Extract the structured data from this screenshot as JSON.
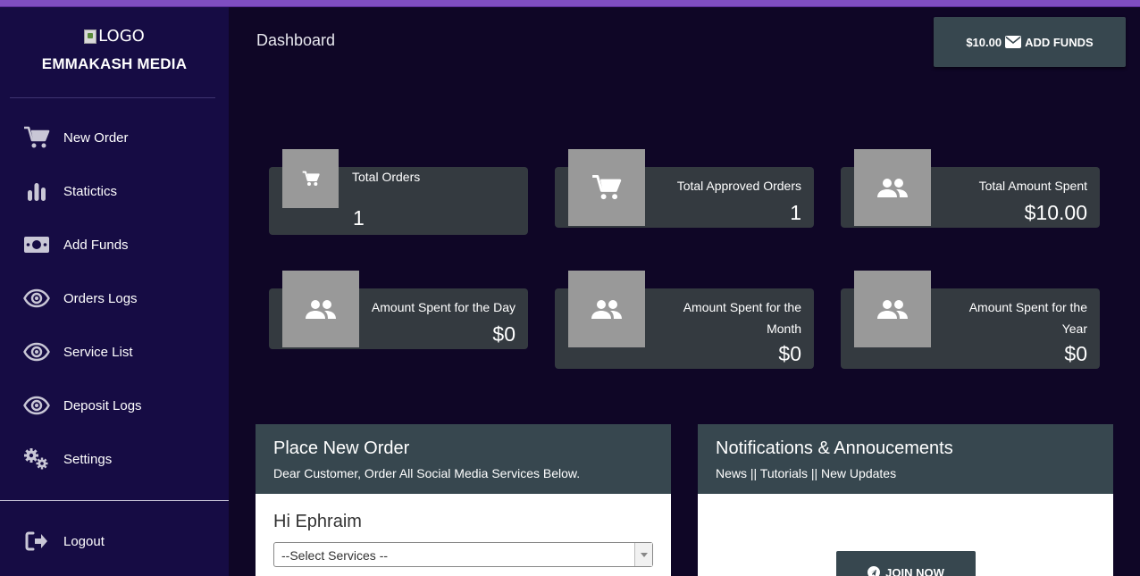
{
  "brand": {
    "logo_alt": "LOGO",
    "name": "EMMAKASH MEDIA"
  },
  "sidebar": {
    "items": [
      {
        "label": "New Order",
        "icon": "cart-icon"
      },
      {
        "label": "Statictics",
        "icon": "bar-chart-icon"
      },
      {
        "label": "Add Funds",
        "icon": "money-icon"
      },
      {
        "label": "Orders Logs",
        "icon": "eye-icon"
      },
      {
        "label": "Service List",
        "icon": "eye-icon"
      },
      {
        "label": "Deposit Logs",
        "icon": "eye-icon"
      },
      {
        "label": "Settings",
        "icon": "gears-icon"
      }
    ],
    "logout": {
      "label": "Logout",
      "icon": "logout-icon"
    }
  },
  "header": {
    "title": "Dashboard",
    "balance": "$10.00",
    "add_funds_label": "ADD FUNDS"
  },
  "stats": [
    {
      "caption": "Total Orders",
      "value": "1",
      "icon": "cart-icon"
    },
    {
      "caption": "Total Approved Orders",
      "value": "1",
      "icon": "cart-icon"
    },
    {
      "caption": "Total Amount Spent",
      "value": "$10.00",
      "icon": "people-icon"
    },
    {
      "caption": "Amount Spent for the Day",
      "value": "$0",
      "icon": "people-icon"
    },
    {
      "caption_line1": "Amount Spent for the",
      "caption_line2": "Month",
      "value": "$0",
      "icon": "people-icon"
    },
    {
      "caption_line1": "Amount Spent for the",
      "caption_line2": "Year",
      "value": "$0",
      "icon": "people-icon"
    }
  ],
  "order_panel": {
    "title": "Place New Order",
    "subtitle": "Dear Customer, Order All Social Media Services Below.",
    "greeting": "Hi Ephraim",
    "select_value": "--Select Services --"
  },
  "notifications_panel": {
    "title": "Notifications & Annoucements",
    "subtitle": "News || Tutorials || New Updates",
    "join_label": "JOIN NOW"
  },
  "colors": {
    "sidebar": "#160c44",
    "background": "#0f0626",
    "card": "#343a40",
    "accent_stripe": "#7f4ec1",
    "panel_header": "#37474f"
  }
}
